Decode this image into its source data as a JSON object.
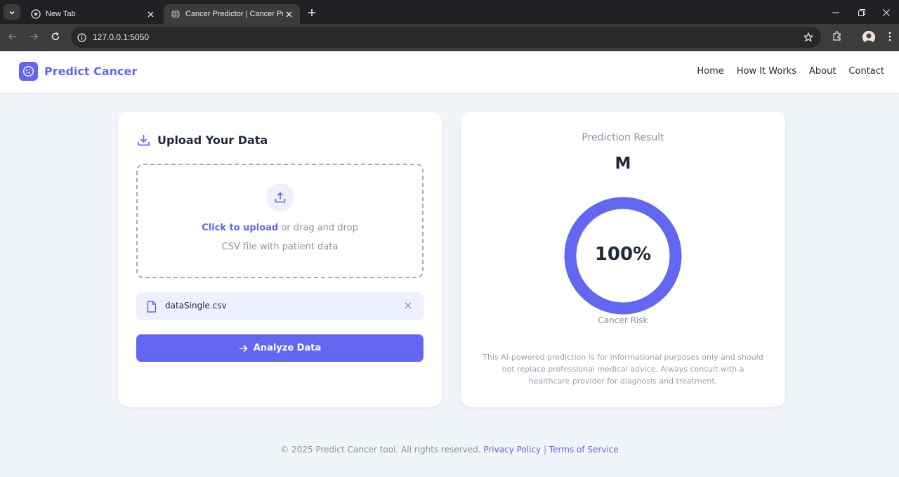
{
  "browser": {
    "tabs": [
      {
        "title": "New Tab",
        "active": false
      },
      {
        "title": "Cancer Predictor | Cancer Prediction",
        "active": true
      }
    ],
    "url": "127.0.0.1:5050"
  },
  "header": {
    "brand": "Predict Cancer",
    "nav": [
      "Home",
      "How It Works",
      "About",
      "Contact"
    ]
  },
  "upload": {
    "title": "Upload Your Data",
    "dropzone_link": "Click to upload",
    "dropzone_text": " or drag and drop",
    "dropzone_hint": "CSV file with patient data",
    "file_name": "dataSingle.csv",
    "analyze_label": "Analyze Data"
  },
  "result": {
    "title": "Prediction Result",
    "label": "M",
    "risk_value": "100%",
    "risk_fraction": 1.0,
    "risk_caption": "Cancer Risk",
    "disclaimer": "This AI-powered prediction is for informational purposes only and should not replace professional medical advice. Always consult with a healthcare provider for diagnosis and treatment."
  },
  "footer": {
    "copyright": "© 2025 Predict Cancer tool. All rights reserved. ",
    "privacy": "Privacy Policy",
    "separator": " | ",
    "terms": "Terms of Service"
  },
  "colors": {
    "accent": "#6366f1",
    "ring_track": "#e5e7eb",
    "page_bg": "#f1f4f9"
  },
  "icons": [
    "chevron-down-icon",
    "chrome-icon",
    "globe-icon",
    "close-icon",
    "plus-icon",
    "minimize-icon",
    "restore-icon",
    "back-icon",
    "forward-icon",
    "reload-icon",
    "info-icon",
    "star-icon",
    "extensions-icon",
    "profile-avatar",
    "more-icon",
    "brand-cell-icon",
    "download-icon",
    "upload-icon",
    "file-icon",
    "arrow-right-icon"
  ]
}
